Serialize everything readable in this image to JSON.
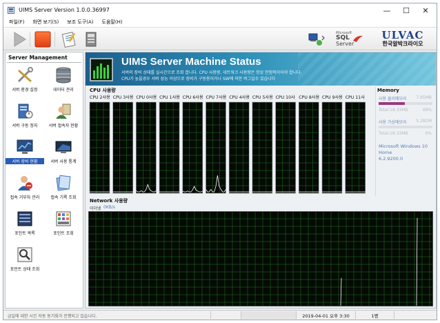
{
  "window": {
    "title": "UIMS Server Version 1.0.0.36997",
    "controls": {
      "minimize": "—",
      "maximize": "☐",
      "close": "✕"
    }
  },
  "menu": [
    {
      "label": "파일(F)"
    },
    {
      "label": "화면 보기(S)"
    },
    {
      "label": "보조 도구(A)"
    },
    {
      "label": "도움말(H)"
    }
  ],
  "toolbar": {
    "sql_logo": {
      "line1": "Microsoft",
      "line2": "SQL",
      "line3": "Server"
    },
    "ulvac_logo": {
      "line1": "ULVAC",
      "line2": "한국알박크라이오"
    }
  },
  "sidebar": {
    "title": "Server Management",
    "items": [
      {
        "label": "서버 환경 설정",
        "icon": "tools-icon"
      },
      {
        "label": "데이터 관리",
        "icon": "database-icon"
      },
      {
        "label": "서버 구동 정지",
        "icon": "server-stop-icon"
      },
      {
        "label": "서버 접속자 현황",
        "icon": "users-icon"
      },
      {
        "label": "서버 장비 현황",
        "icon": "monitor-chart-icon",
        "selected": true
      },
      {
        "label": "서버 사용 통계",
        "icon": "monitor-stats-icon"
      },
      {
        "label": "접속 거부자 관리",
        "icon": "user-block-icon"
      },
      {
        "label": "접속 기록 조회",
        "icon": "log-icon"
      },
      {
        "label": "포인트 목록",
        "icon": "point-list-icon"
      },
      {
        "label": "포인트 조회",
        "icon": "point-view-icon"
      },
      {
        "label": "포인트 상태 조회",
        "icon": "search-icon"
      }
    ]
  },
  "header": {
    "title": "UIMS Server Machine Status",
    "desc1": "서버의 장비 상태를 실시간으로 조회 합니다. CPU 사용량, 네트워크 사용량은 항상 안정적이어야 합니다.",
    "desc2": "CPU가 높을경우 서버 성능 이상으로 장비가 구동용이거나 SW에 의한 버그일수 있습니다"
  },
  "cpu": {
    "title": "CPU 사용량",
    "cores": [
      {
        "label": "CPU 2사용",
        "spike": 0.0
      },
      {
        "label": "CPU 3사용",
        "spike": 0.0
      },
      {
        "label": "CPU 0사용",
        "spike": 0.08
      },
      {
        "label": "CPU 1사용",
        "spike": 0.0
      },
      {
        "label": "CPU 6사용",
        "spike": 0.06
      },
      {
        "label": "CPU 7사용",
        "spike": 0.18
      },
      {
        "label": "CPU 4사용",
        "spike": 0.0
      },
      {
        "label": "CPU 5사용",
        "spike": 0.0
      },
      {
        "label": "CPU 10사",
        "spike": 0.0
      },
      {
        "label": "CPU 8사용",
        "spike": 0.0
      },
      {
        "label": "CPU 9사용",
        "spike": 0.0
      },
      {
        "label": "CPU 11사",
        "spike": 0.0
      }
    ]
  },
  "memory": {
    "title": "Memory",
    "physical": {
      "label": "사용 물리메모리",
      "value": "7.95MB",
      "total": "Total:19.33MB",
      "percent": "49%",
      "fill": 0.49
    },
    "virtual": {
      "label": "사용 가상메모리",
      "value": "5.282M",
      "total": "Total:19.33MB",
      "percent": "0%",
      "fill": 0.0
    },
    "os": {
      "line1": "Microsoft Windows 10",
      "line2": "Home",
      "line3": "6.2.9200.0"
    }
  },
  "network": {
    "title": "Network 사용량",
    "adapter": "이더넷",
    "rate": "0KB/s"
  },
  "status": {
    "message": "금일에 대한 시간 자동 동기화가 진행되고 있습니다.",
    "datetime": "2019-04-01 오후 3:30",
    "users": "1명"
  },
  "colors": {
    "graph_bg": "#050a05",
    "graph_grid": "#1e7a1e",
    "graph_line": "#ffffff",
    "banner_start": "#1b5f8d",
    "banner_end": "#74c6de",
    "selection": "#2a5db8"
  }
}
